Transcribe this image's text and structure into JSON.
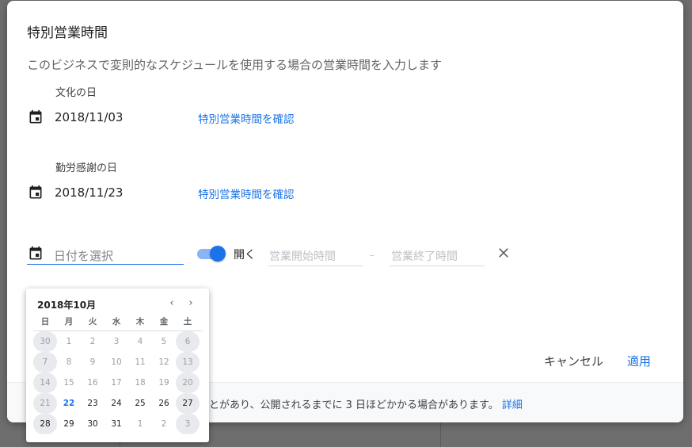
{
  "dialog": {
    "title": "特別営業時間",
    "description": "このビジネスで変則的なスケジュールを使用する場合の営業時間を入力します"
  },
  "entries": [
    {
      "holiday": "文化の日",
      "date": "2018/11/03",
      "link": "特別営業時間を確認"
    },
    {
      "holiday": "勤労感謝の日",
      "date": "2018/11/23",
      "link": "特別営業時間を確認"
    }
  ],
  "new_entry": {
    "date_placeholder": "日付を選択",
    "toggle_on": true,
    "open_label": "開く",
    "start_placeholder": "営業開始時間",
    "separator": "–",
    "end_placeholder": "営業終了時間"
  },
  "actions": {
    "cancel": "キャンセル",
    "apply": "適用"
  },
  "footer": {
    "note": "とがあり、公開されるまでに 3 日ほどかかる場合があります。",
    "link": "詳細"
  },
  "datepicker": {
    "month": "2018年10月",
    "prev": "‹",
    "next": "›",
    "weekdays": [
      "日",
      "月",
      "火",
      "水",
      "木",
      "金",
      "土"
    ],
    "weeks": [
      [
        {
          "d": "30",
          "s": "disabled"
        },
        {
          "d": "1",
          "s": "muted"
        },
        {
          "d": "2",
          "s": "muted"
        },
        {
          "d": "3",
          "s": "muted"
        },
        {
          "d": "4",
          "s": "muted"
        },
        {
          "d": "5",
          "s": "muted"
        },
        {
          "d": "6",
          "s": "disabled"
        }
      ],
      [
        {
          "d": "7",
          "s": "disabled"
        },
        {
          "d": "8",
          "s": "muted"
        },
        {
          "d": "9",
          "s": "muted"
        },
        {
          "d": "10",
          "s": "muted"
        },
        {
          "d": "11",
          "s": "muted"
        },
        {
          "d": "12",
          "s": "muted"
        },
        {
          "d": "13",
          "s": "disabled"
        }
      ],
      [
        {
          "d": "14",
          "s": "disabled"
        },
        {
          "d": "15",
          "s": "muted"
        },
        {
          "d": "16",
          "s": "muted"
        },
        {
          "d": "17",
          "s": "muted"
        },
        {
          "d": "18",
          "s": "muted"
        },
        {
          "d": "19",
          "s": "muted"
        },
        {
          "d": "20",
          "s": "disabled"
        }
      ],
      [
        {
          "d": "21",
          "s": "disabled"
        },
        {
          "d": "22",
          "s": "today"
        },
        {
          "d": "23",
          "s": "active"
        },
        {
          "d": "24",
          "s": "active"
        },
        {
          "d": "25",
          "s": "active"
        },
        {
          "d": "26",
          "s": "active"
        },
        {
          "d": "27",
          "s": "active-disabled"
        }
      ],
      [
        {
          "d": "28",
          "s": "active-disabled"
        },
        {
          "d": "29",
          "s": "active"
        },
        {
          "d": "30",
          "s": "active"
        },
        {
          "d": "31",
          "s": "active"
        },
        {
          "d": "1",
          "s": "muted"
        },
        {
          "d": "2",
          "s": "muted"
        },
        {
          "d": "3",
          "s": "disabled"
        }
      ]
    ]
  },
  "colors": {
    "accent": "#1a73e8",
    "toggle_track": "#8ab4f8"
  }
}
